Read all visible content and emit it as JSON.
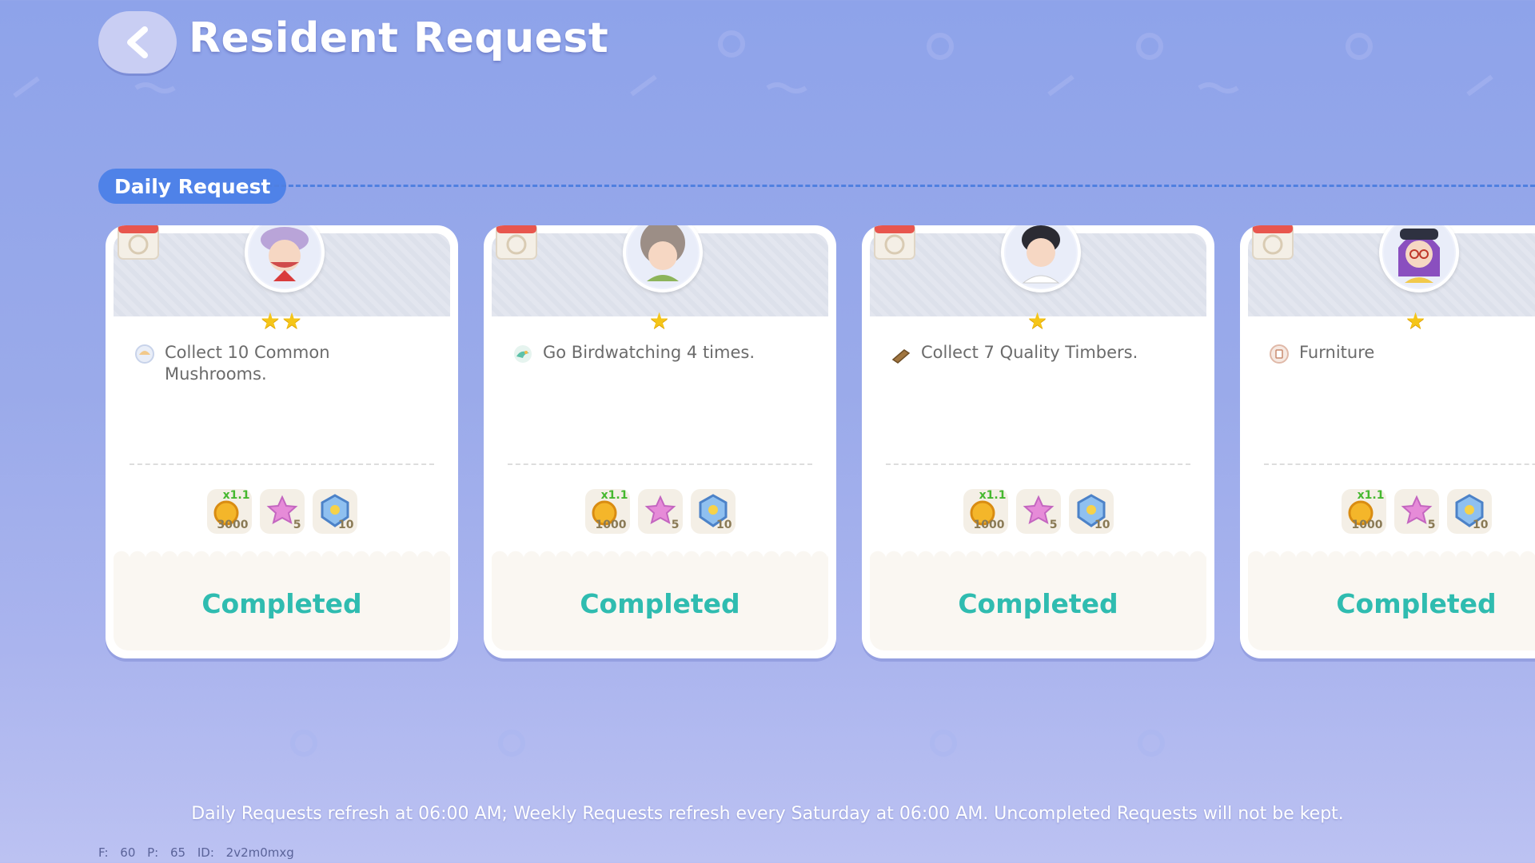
{
  "header": {
    "title": "Resident Request",
    "back_icon": "chevron-left-icon"
  },
  "section": {
    "label": "Daily Request"
  },
  "cards": [
    {
      "resident": "grandpa-chef",
      "stars": "★★",
      "task_icon": "mushroom-icon",
      "task": "Collect 10 Common Mushrooms.",
      "rewards": [
        {
          "icon": "coin-icon",
          "amount": "3000",
          "multiplier": "x1.1"
        },
        {
          "icon": "star-icon",
          "amount": "5"
        },
        {
          "icon": "badge-icon",
          "amount": "10"
        }
      ],
      "status": "Completed"
    },
    {
      "resident": "curly-hair-girl",
      "stars": "★",
      "task_icon": "bird-icon",
      "task": "Go Birdwatching 4 times.",
      "rewards": [
        {
          "icon": "coin-icon",
          "amount": "1000",
          "multiplier": "x1.1"
        },
        {
          "icon": "star-icon",
          "amount": "5"
        },
        {
          "icon": "badge-icon",
          "amount": "10"
        }
      ],
      "status": "Completed"
    },
    {
      "resident": "dark-hair-boy",
      "stars": "★",
      "task_icon": "timber-icon",
      "task": "Collect 7 Quality Timbers.",
      "rewards": [
        {
          "icon": "coin-icon",
          "amount": "1000",
          "multiplier": "x1.1"
        },
        {
          "icon": "star-icon",
          "amount": "5"
        },
        {
          "icon": "badge-icon",
          "amount": "10"
        }
      ],
      "status": "Completed"
    },
    {
      "resident": "purple-hair-girl",
      "stars": "★",
      "task_icon": "furniture-icon",
      "task": "Furniture",
      "rewards": [
        {
          "icon": "coin-icon",
          "amount": "1000",
          "multiplier": "x1.1"
        },
        {
          "icon": "star-icon",
          "amount": "5"
        },
        {
          "icon": "badge-icon",
          "amount": "10"
        }
      ],
      "status": "Completed"
    }
  ],
  "footer": {
    "note": "Daily Requests refresh at 06:00 AM; Weekly Requests refresh every Saturday at 06:00 AM. Uncompleted Requests will not be kept.",
    "debug": "F: 60  P: 65  ID: 2v2m0mxg"
  },
  "colors": {
    "accent": "#4f82e8",
    "completed": "#2fbcb0",
    "star": "#f5c518"
  }
}
